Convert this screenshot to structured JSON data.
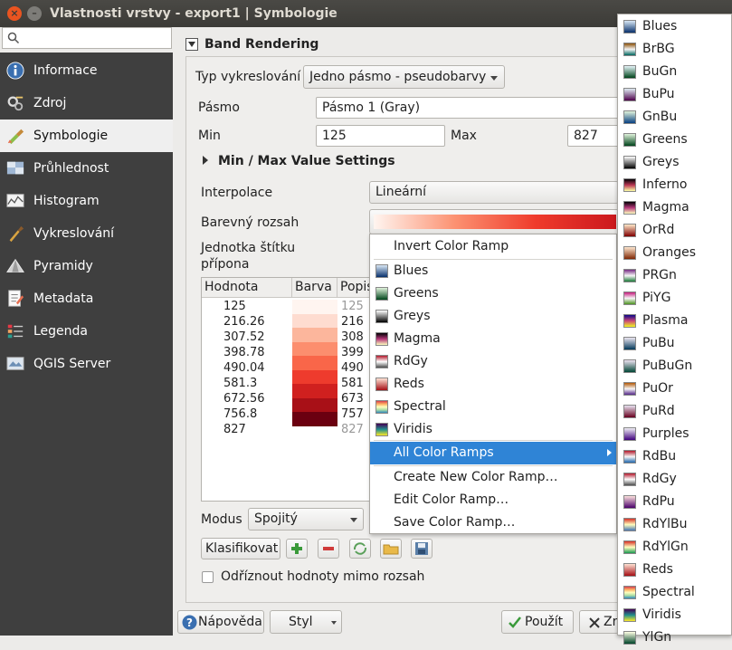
{
  "window": {
    "title": "Vlastnosti vrstvy - export1 | Symbologie"
  },
  "search": {
    "placeholder": ""
  },
  "sidebar": {
    "items": [
      {
        "label": "Informace",
        "icon": "info-icon"
      },
      {
        "label": "Zdroj",
        "icon": "source-icon"
      },
      {
        "label": "Symbologie",
        "icon": "symbology-icon"
      },
      {
        "label": "Průhlednost",
        "icon": "transparency-icon"
      },
      {
        "label": "Histogram",
        "icon": "histogram-icon"
      },
      {
        "label": "Vykreslování",
        "icon": "rendering-icon"
      },
      {
        "label": "Pyramidy",
        "icon": "pyramids-icon"
      },
      {
        "label": "Metadata",
        "icon": "metadata-icon"
      },
      {
        "label": "Legenda",
        "icon": "legend-icon"
      },
      {
        "label": "QGIS Server",
        "icon": "server-icon"
      }
    ]
  },
  "band": {
    "title": "Band Rendering",
    "render_type_label": "Typ vykreslování",
    "render_type_value": "Jedno pásmo - pseudobarvy",
    "band_label": "Pásmo",
    "band_value": "Pásmo 1 (Gray)",
    "min_label": "Min",
    "min_value": "125",
    "max_label": "Max",
    "max_value": "827",
    "minmax_settings": "Min / Max Value Settings",
    "interp_label": "Interpolace",
    "interp_value": "Lineární",
    "ramp_label": "Barevný rozsah",
    "unit_label1": "Jednotka štítku",
    "unit_label2": "přípona",
    "mode_label": "Modus",
    "mode_value": "Spojitý",
    "classify_label": "Klasifikovat",
    "clip_label": "Odříznout hodnoty mimo rozsah"
  },
  "table": {
    "headers": [
      "Hodnota",
      "Barva",
      "Popis"
    ],
    "rows": [
      {
        "value": "125",
        "label": "125",
        "color": "#fff5f0"
      },
      {
        "value": "216.26",
        "label": "216",
        "color": "#fedcd0"
      },
      {
        "value": "307.52",
        "label": "308",
        "color": "#fcb69c"
      },
      {
        "value": "398.78",
        "label": "399",
        "color": "#fc8e6e"
      },
      {
        "value": "490.04",
        "label": "490",
        "color": "#f96649"
      },
      {
        "value": "581.3",
        "label": "581",
        "color": "#ee3b2d"
      },
      {
        "value": "672.56",
        "label": "673",
        "color": "#d0201f"
      },
      {
        "value": "756.8",
        "label": "757",
        "color": "#a81017"
      },
      {
        "value": "827",
        "label": "827",
        "color": "#6b0010"
      }
    ]
  },
  "menu": {
    "invert": "Invert Color Ramp",
    "items": [
      {
        "label": "Blues",
        "colors": [
          "#d8e7f5",
          "#08306b"
        ]
      },
      {
        "label": "Greens",
        "colors": [
          "#dff2da",
          "#00441b"
        ]
      },
      {
        "label": "Greys",
        "colors": [
          "#ffffff",
          "#000000"
        ]
      },
      {
        "label": "Magma",
        "colors": [
          "#000004",
          "#b63679",
          "#fcfdbf"
        ]
      },
      {
        "label": "RdGy",
        "colors": [
          "#b2182b",
          "#ffffff",
          "#4d4d4d"
        ]
      },
      {
        "label": "Reds",
        "colors": [
          "#fee0d2",
          "#a50f15"
        ]
      },
      {
        "label": "Spectral",
        "colors": [
          "#d53e4f",
          "#fdae61",
          "#ffffbf",
          "#abdda4",
          "#3288bd"
        ]
      },
      {
        "label": "Viridis",
        "colors": [
          "#440154",
          "#21908d",
          "#fde725"
        ]
      }
    ],
    "all_ramps": "All Color Ramps",
    "create": "Create New Color Ramp…",
    "edit": "Edit Color Ramp…",
    "save": "Save Color Ramp…"
  },
  "submenu": {
    "items": [
      {
        "label": "Blues",
        "colors": [
          "#d8e7f5",
          "#08306b"
        ]
      },
      {
        "label": "BrBG",
        "colors": [
          "#8c510a",
          "#f5f5f5",
          "#01665e"
        ]
      },
      {
        "label": "BuGn",
        "colors": [
          "#e5f5f9",
          "#00441b"
        ]
      },
      {
        "label": "BuPu",
        "colors": [
          "#e0ecf4",
          "#4d004b"
        ]
      },
      {
        "label": "GnBu",
        "colors": [
          "#e0f3db",
          "#084081"
        ]
      },
      {
        "label": "Greens",
        "colors": [
          "#dff2da",
          "#00441b"
        ]
      },
      {
        "label": "Greys",
        "colors": [
          "#ffffff",
          "#000000"
        ]
      },
      {
        "label": "Inferno",
        "colors": [
          "#000004",
          "#bc3754",
          "#fcffa4"
        ]
      },
      {
        "label": "Magma",
        "colors": [
          "#000004",
          "#b63679",
          "#fcfdbf"
        ]
      },
      {
        "label": "OrRd",
        "colors": [
          "#fee8c8",
          "#7f0000"
        ]
      },
      {
        "label": "Oranges",
        "colors": [
          "#fee6ce",
          "#7f2704"
        ]
      },
      {
        "label": "PRGn",
        "colors": [
          "#762a83",
          "#f7f7f7",
          "#1b7837"
        ]
      },
      {
        "label": "PiYG",
        "colors": [
          "#c51b7d",
          "#f7f7f7",
          "#4d9221"
        ]
      },
      {
        "label": "Plasma",
        "colors": [
          "#0d0887",
          "#cc4778",
          "#f0f921"
        ]
      },
      {
        "label": "PuBu",
        "colors": [
          "#ece7f2",
          "#023858"
        ]
      },
      {
        "label": "PuBuGn",
        "colors": [
          "#ece2f0",
          "#014636"
        ]
      },
      {
        "label": "PuOr",
        "colors": [
          "#b35806",
          "#f7f7f7",
          "#542788"
        ]
      },
      {
        "label": "PuRd",
        "colors": [
          "#e7e1ef",
          "#67001f"
        ]
      },
      {
        "label": "Purples",
        "colors": [
          "#efedf5",
          "#3f007d"
        ]
      },
      {
        "label": "RdBu",
        "colors": [
          "#b2182b",
          "#f7f7f7",
          "#2166ac"
        ]
      },
      {
        "label": "RdGy",
        "colors": [
          "#b2182b",
          "#ffffff",
          "#4d4d4d"
        ]
      },
      {
        "label": "RdPu",
        "colors": [
          "#fde0dd",
          "#49006a"
        ]
      },
      {
        "label": "RdYlBu",
        "colors": [
          "#d73027",
          "#ffffbf",
          "#4575b4"
        ]
      },
      {
        "label": "RdYlGn",
        "colors": [
          "#d73027",
          "#ffffbf",
          "#1a9850"
        ]
      },
      {
        "label": "Reds",
        "colors": [
          "#fee0d2",
          "#a50f15"
        ]
      },
      {
        "label": "Spectral",
        "colors": [
          "#d53e4f",
          "#fdae61",
          "#ffffbf",
          "#abdda4",
          "#3288bd"
        ]
      },
      {
        "label": "Viridis",
        "colors": [
          "#440154",
          "#21908d",
          "#fde725"
        ]
      },
      {
        "label": "YlGn",
        "colors": [
          "#ffffe5",
          "#004529"
        ]
      }
    ]
  },
  "footer": {
    "help_label": "Nápověda",
    "style_label": "Styl",
    "apply_label": "Použít",
    "close_label": "Zr"
  },
  "colors": {
    "accent": "#2f84d6",
    "sidebar_bg": "#3f3f3f"
  }
}
